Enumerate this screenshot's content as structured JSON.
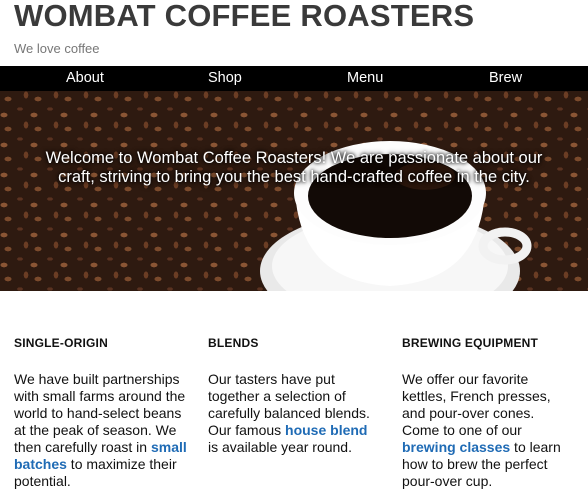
{
  "header": {
    "title": "WOMBAT COFFEE ROASTERS",
    "tagline": "We love coffee"
  },
  "nav": {
    "items": [
      "About",
      "Shop",
      "Menu",
      "Brew"
    ]
  },
  "hero": {
    "text": "Welcome to Wombat Coffee Roasters! We are passionate about our craft, striving to bring you the best hand-crafted coffee in the city."
  },
  "features": [
    {
      "heading": "SINGLE-ORIGIN",
      "text_before": "We have built partnerships with small farms around the world to hand-select beans at the peak of season. We then carefully roast in ",
      "link": "small batches",
      "text_after": " to maximize their potential."
    },
    {
      "heading": "BLENDS",
      "text_before": "Our tasters have put together a selection of carefully balanced blends. Our famous ",
      "link": "house blend",
      "text_after": " is available year round."
    },
    {
      "heading": "BREWING EQUIPMENT",
      "text_before": "We offer our favorite kettles, French presses, and pour-over cones. Come to one of our ",
      "link": "brewing classes",
      "text_after": " to learn how to brew the perfect pour-over cup."
    }
  ],
  "colors": {
    "nav_background": "#000000",
    "link": "#1f6bb5",
    "title": "#3a3a3a"
  }
}
